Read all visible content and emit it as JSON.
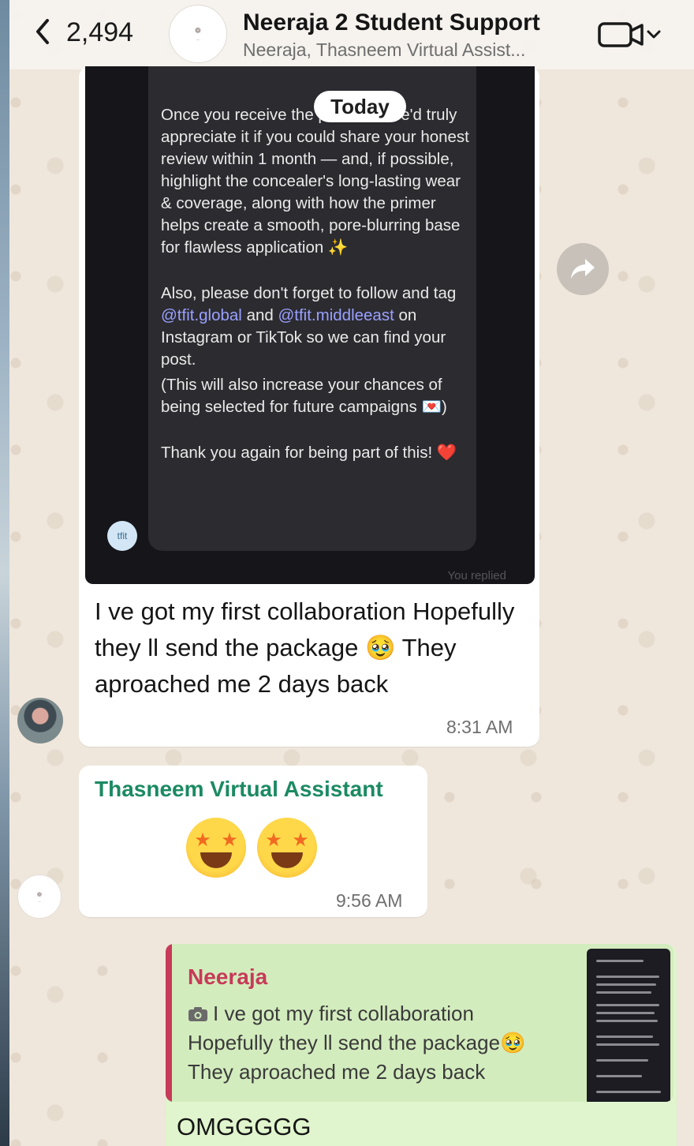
{
  "header": {
    "back_count": "2,494",
    "title": "Neeraja 2 Student Support",
    "subtitle": "Neeraja, Thasneem Virtual Assist..."
  },
  "date_divider": "Today",
  "messages": [
    {
      "inner_screenshot": {
        "para1": "Once you receive the products, we'd truly appreciate it if you could share your honest review within 1 month — and, if possible, highlight the concealer's long-lasting wear & coverage, along with how the primer helps create a smooth, pore-blurring base for flawless application ✨",
        "para2_pre": "Also, please don't forget to follow and tag ",
        "mention1": "@tfit.global",
        "para2_mid": " and ",
        "mention2": "@tfit.middleeast",
        "para2_post": " on Instagram or TikTok so we can find your post.",
        "para3": "(This will also increase your chances of being selected for future campaigns 💌)",
        "para4": "Thank you again for being part of this! ❤️",
        "avatar_text": "tfit",
        "you_replied": "You replied"
      },
      "text": "I ve got my first collaboration Hopefully they ll send the package 🥹 They aproached me 2 days back",
      "time": "8:31 AM"
    },
    {
      "sender": "Thasneem Virtual Assistant",
      "emoji_name": "star-struck",
      "time": "9:56 AM"
    },
    {
      "quoted": {
        "sender": "Neeraja",
        "line1": "I ve got my first collaboration",
        "line2": "Hopefully they ll send the package🥹",
        "line3": "They aproached me 2 days back"
      },
      "text": "OMGGGGG"
    }
  ],
  "colors": {
    "sender_green": "#1b8a62",
    "quote_red": "#c73a58",
    "outgoing_bg": "#e0f5cd"
  }
}
